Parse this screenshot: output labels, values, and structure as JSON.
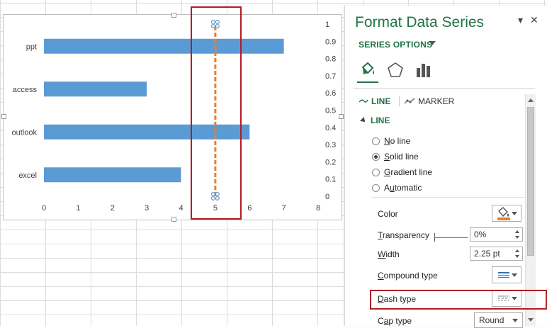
{
  "chart_data": {
    "type": "bar",
    "orientation": "horizontal",
    "categories": [
      "ppt",
      "access",
      "outlook",
      "excel"
    ],
    "values": [
      7,
      3,
      6,
      4
    ],
    "xlim": [
      0,
      8
    ],
    "xticks": [
      "0",
      "1",
      "2",
      "3",
      "4",
      "5",
      "6",
      "7",
      "8"
    ],
    "secondary_ylim": [
      0,
      1
    ],
    "secondary_yticks": [
      "0",
      "0.1",
      "0.2",
      "0.3",
      "0.4",
      "0.5",
      "0.6",
      "0.7",
      "0.8",
      "0.9",
      "1"
    ],
    "bar_color": "#5b9bd5",
    "vertical_line": {
      "x": 5,
      "y_start": 0,
      "y_end": 1,
      "color": "#ed7d31",
      "style": "dashed"
    },
    "grid": false
  },
  "pane": {
    "title": "Format Data Series",
    "collapse_glyph": "▾",
    "close_glyph": "✕",
    "series_options_label": "SERIES OPTIONS",
    "tab_icons": [
      "paint-bucket-icon",
      "pentagon-icon",
      "bar-chart-icon"
    ],
    "subtab_line": "LINE",
    "subtab_marker": "MARKER",
    "section_line": "LINE",
    "radio_options": [
      {
        "label": "No line",
        "checked": false
      },
      {
        "label": "Solid line",
        "checked": true
      },
      {
        "label": "Gradient line",
        "checked": false
      },
      {
        "label": "Automatic",
        "checked": false
      }
    ],
    "color_label": "Color",
    "color_value": "#ed7d31",
    "transparency_label": "Transparency",
    "transparency_value": "0%",
    "width_label": "Width",
    "width_value": "2.25 pt",
    "compound_label": "Compound type",
    "dash_label": "Dash type",
    "cap_label": "Cap type",
    "cap_value": "Round"
  },
  "colors": {
    "accent_green": "#217346",
    "highlight_red": "#b01e23"
  }
}
